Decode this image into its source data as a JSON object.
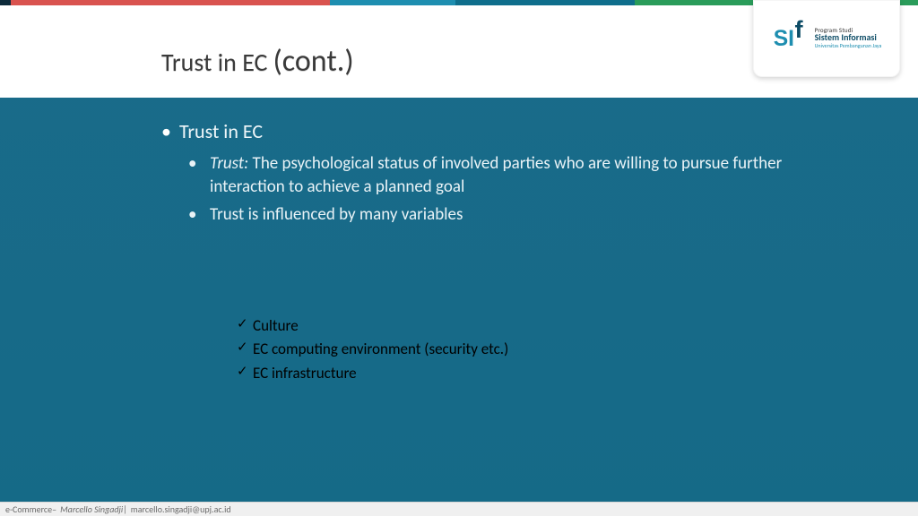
{
  "title": {
    "small": "Trust in EC",
    "big": "(cont.)"
  },
  "logo": {
    "line1": "Program Studi",
    "line2": "Sistem Informasi",
    "line3": "Universitas Pembangunan Jaya"
  },
  "outline": {
    "heading": "Trust in EC",
    "items": [
      {
        "term": "Trust:",
        "rest": " The psychological status of involved parties who are willing to pursue further interaction to achieve a planned goal"
      },
      {
        "term": "",
        "rest": "Trust is influenced by many variables"
      }
    ]
  },
  "checklist": [
    "Culture",
    "EC computing environment (security etc.)",
    "EC infrastructure"
  ],
  "footer": {
    "course": "e-Commerce",
    "separator1": " – ",
    "author": "Marcello Singadji",
    "separator2": "  |  ",
    "email": "marcello.singadji@upj.ac.id"
  }
}
